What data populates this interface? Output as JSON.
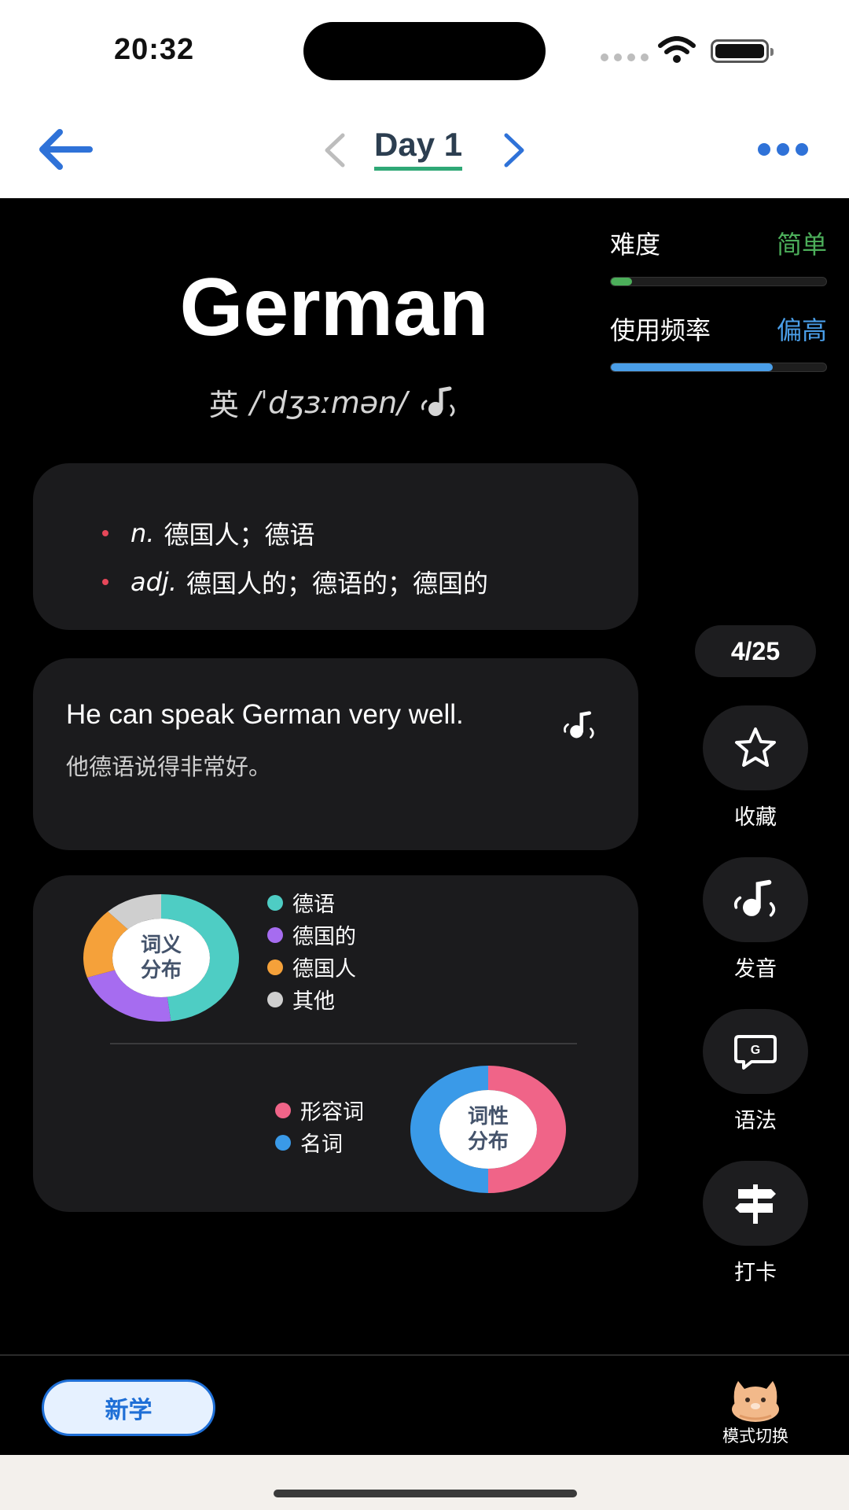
{
  "status": {
    "time": "20:32"
  },
  "nav": {
    "title": "Day 1"
  },
  "word": {
    "text": "German",
    "accent": "英",
    "phonetic": "/ˈdʒɜːmən/"
  },
  "metrics": {
    "difficulty": {
      "label": "难度",
      "value": "简单",
      "value_color": "#4cae5a",
      "level": 0.1,
      "fill_color": "#4cae5a"
    },
    "frequency": {
      "label": "使用频率",
      "value": "偏高",
      "value_color": "#4a9ee8",
      "level": 0.75,
      "fill_color": "#4a9ee8"
    }
  },
  "definitions": [
    {
      "pos": "n.",
      "meaning": "德国人；德语"
    },
    {
      "pos": "adj.",
      "meaning": "德国人的；德语的；德国的"
    }
  ],
  "example": {
    "en": "He can speak German very well.",
    "zh": "他德语说得非常好。"
  },
  "charts": {
    "sense": {
      "center_line1": "词义",
      "center_line2": "分布",
      "legend": [
        {
          "label": "德语",
          "color": "#4ecdc4"
        },
        {
          "label": "德国的",
          "color": "#a66cf0"
        },
        {
          "label": "德国人",
          "color": "#f5a13a"
        },
        {
          "label": "其他",
          "color": "#cfcfcf"
        }
      ]
    },
    "pos": {
      "center_line1": "词性",
      "center_line2": "分布",
      "legend": [
        {
          "label": "形容词",
          "color": "#f06488"
        },
        {
          "label": "名词",
          "color": "#3a9ae8"
        }
      ]
    }
  },
  "chart_data": [
    {
      "type": "pie",
      "categories": [
        "德语",
        "德国的",
        "德国人",
        "其他"
      ],
      "values": [
        48,
        22,
        18,
        12
      ]
    },
    {
      "type": "pie",
      "categories": [
        "形容词",
        "名词"
      ],
      "values": [
        50,
        50
      ]
    }
  ],
  "sidebar": {
    "counter": "4/25",
    "actions": [
      {
        "label": "收藏",
        "icon": "star-icon"
      },
      {
        "label": "发音",
        "icon": "audio-icon"
      },
      {
        "label": "语法",
        "icon": "grammar-icon"
      },
      {
        "label": "打卡",
        "icon": "signpost-icon"
      }
    ]
  },
  "bottom": {
    "new_label": "新学",
    "mode_label": "模式切换"
  }
}
